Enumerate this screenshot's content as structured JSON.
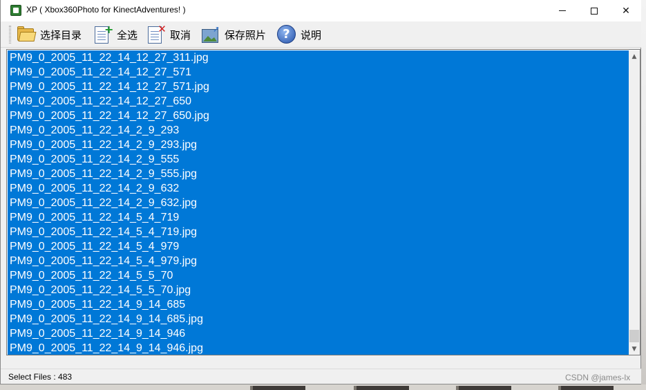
{
  "window": {
    "title": "XP ( Xbox360Photo for KinectAdventures! )",
    "minimize_label": "—",
    "maximize_label": "☐",
    "close_label": "✕"
  },
  "toolbar": {
    "select_dir_label": "选择目录",
    "select_all_label": "全选",
    "cancel_label": "取消",
    "save_photos_label": "保存照片",
    "help_label": "说明"
  },
  "file_list": {
    "items": [
      "PM9_0_2005_11_22_14_12_27_311.jpg",
      "PM9_0_2005_11_22_14_12_27_571",
      "PM9_0_2005_11_22_14_12_27_571.jpg",
      "PM9_0_2005_11_22_14_12_27_650",
      "PM9_0_2005_11_22_14_12_27_650.jpg",
      "PM9_0_2005_11_22_14_2_9_293",
      "PM9_0_2005_11_22_14_2_9_293.jpg",
      "PM9_0_2005_11_22_14_2_9_555",
      "PM9_0_2005_11_22_14_2_9_555.jpg",
      "PM9_0_2005_11_22_14_2_9_632",
      "PM9_0_2005_11_22_14_2_9_632.jpg",
      "PM9_0_2005_11_22_14_5_4_719",
      "PM9_0_2005_11_22_14_5_4_719.jpg",
      "PM9_0_2005_11_22_14_5_4_979",
      "PM9_0_2005_11_22_14_5_4_979.jpg",
      "PM9_0_2005_11_22_14_5_5_70",
      "PM9_0_2005_11_22_14_5_5_70.jpg",
      "PM9_0_2005_11_22_14_9_14_685",
      "PM9_0_2005_11_22_14_9_14_685.jpg",
      "PM9_0_2005_11_22_14_9_14_946",
      "PM9_0_2005_11_22_14_9_14_946.jpg"
    ],
    "selection_color": "#0078d7"
  },
  "status": {
    "text": "Select Files : 483"
  },
  "watermark": "CSDN @james-lx"
}
